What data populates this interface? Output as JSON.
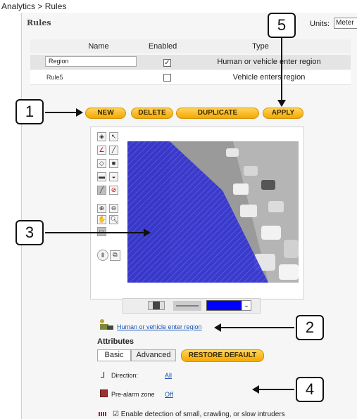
{
  "breadcrumb": "Analytics > Rules",
  "panel_title": "Rules",
  "units": {
    "label": "Units:",
    "value": "Meter"
  },
  "table": {
    "headers": {
      "name": "Name",
      "enabled": "Enabled",
      "type": "Type"
    },
    "rows": [
      {
        "name": "Region",
        "enabled": "✓",
        "type": "Human or vehicle enter region"
      },
      {
        "name": "Rule5",
        "enabled": "",
        "type": "Vehicle enters region"
      }
    ]
  },
  "buttons": {
    "new": "NEW",
    "delete": "DELETE",
    "duplicate": "DUPLICATE",
    "apply": "APPLY",
    "restore_default": "RESTORE DEFAULT"
  },
  "callouts": {
    "c1": "1",
    "c2": "2",
    "c3": "3",
    "c4": "4",
    "c5": "5"
  },
  "rule_link": "Human or vehicle enter region",
  "attributes": {
    "title": "Attributes",
    "tabs": {
      "basic": "Basic",
      "advanced": "Advanced"
    },
    "direction_label": "Direction:",
    "direction_value": "All",
    "prealarm_label": "Pre-alarm zone",
    "prealarm_value": "Off",
    "intruders_label": "Enable detection of small, crawling, or slow intruders",
    "intruders_checked": "☑"
  },
  "colors": {
    "accent_orange": "#f5a800",
    "overlay_blue": "#2020c8",
    "color_swatch": "#0000ff",
    "link_blue": "#1a55b8"
  }
}
